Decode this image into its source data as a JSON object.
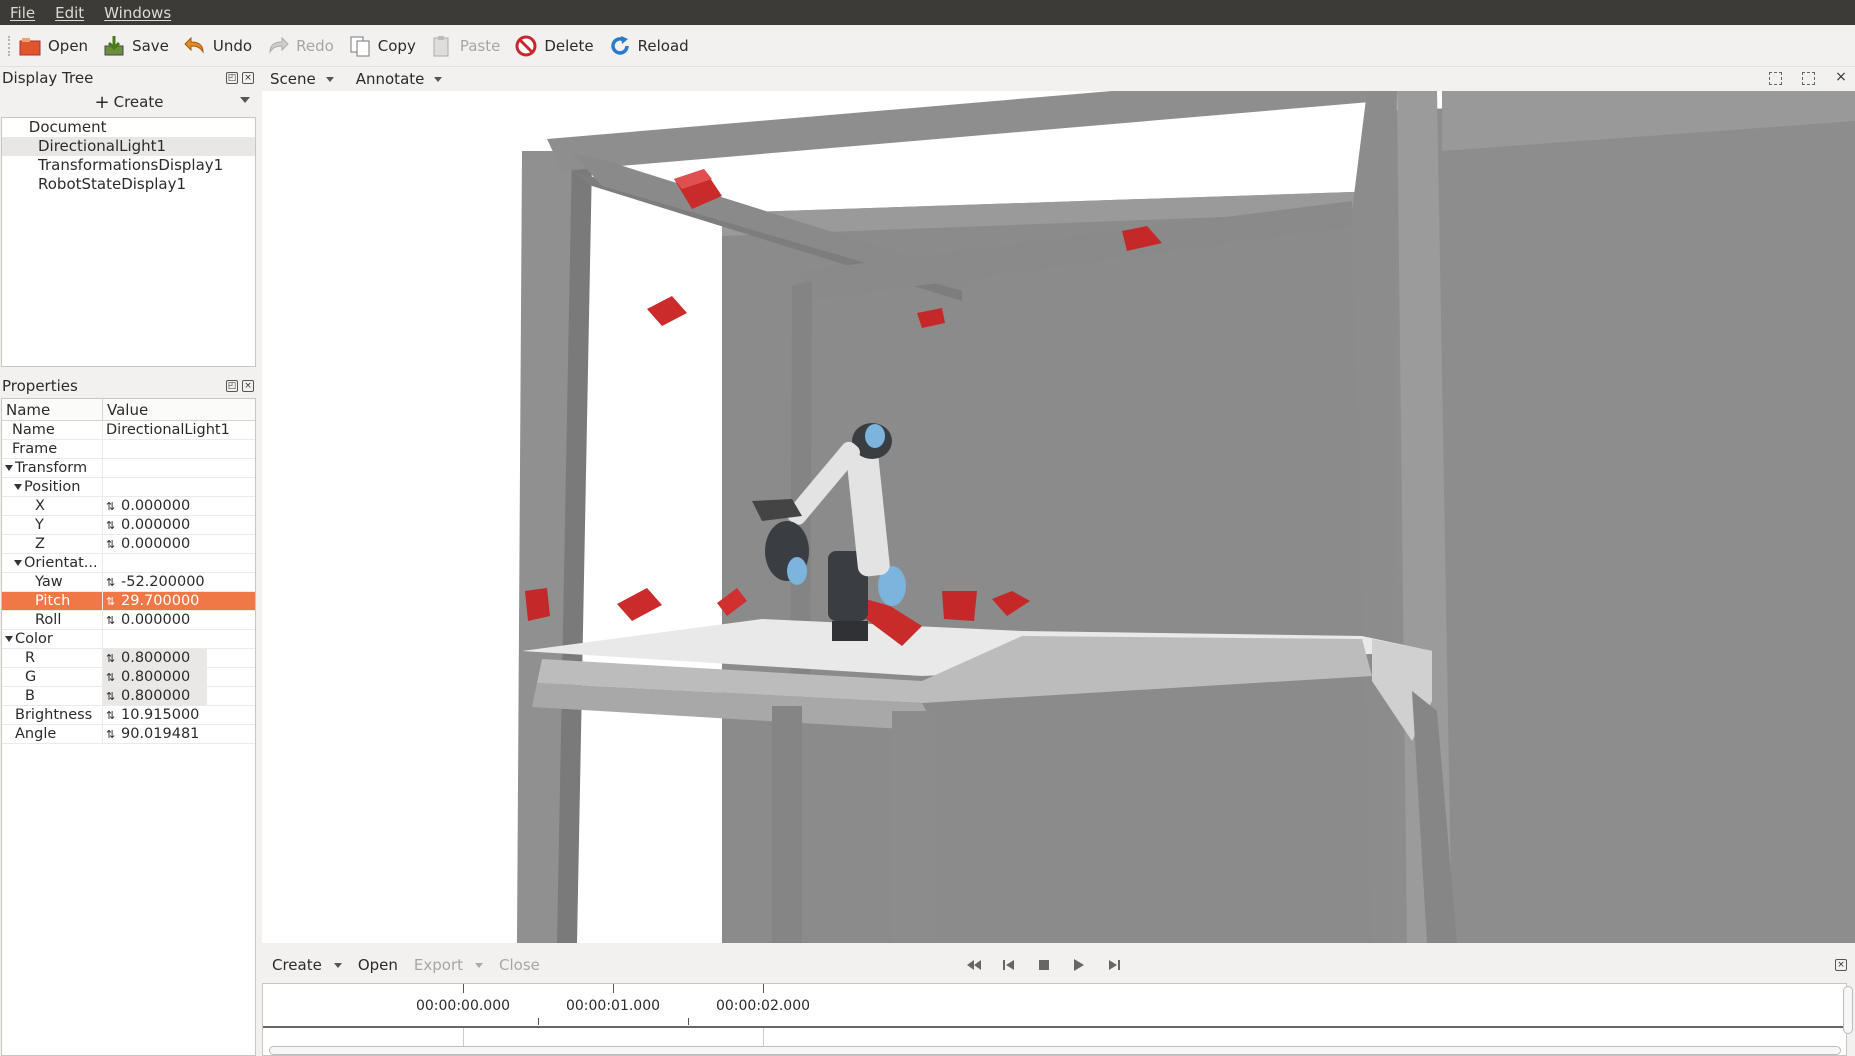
{
  "menubar": {
    "items": [
      "File",
      "Edit",
      "Windows"
    ]
  },
  "toolbar": {
    "open": "Open",
    "save": "Save",
    "undo": "Undo",
    "redo": "Redo",
    "copy": "Copy",
    "paste": "Paste",
    "delete": "Delete",
    "reload": "Reload"
  },
  "display_tree": {
    "title": "Display Tree",
    "create_label": "Create",
    "root": "Document",
    "items": [
      "DirectionalLight1",
      "TransformationsDisplay1",
      "RobotStateDisplay1"
    ],
    "selected": "DirectionalLight1"
  },
  "properties": {
    "title": "Properties",
    "col_name": "Name",
    "col_value": "Value",
    "rows": {
      "name": {
        "label": "Name",
        "value": "DirectionalLight1"
      },
      "frame": {
        "label": "Frame",
        "value": ""
      },
      "transform": {
        "label": "Transform"
      },
      "position": {
        "label": "Position"
      },
      "x": {
        "label": "X",
        "value": "0.000000"
      },
      "y": {
        "label": "Y",
        "value": "0.000000"
      },
      "z": {
        "label": "Z",
        "value": "0.000000"
      },
      "orientation": {
        "label": "Orientat..."
      },
      "yaw": {
        "label": "Yaw",
        "value": "-52.200000"
      },
      "pitch": {
        "label": "Pitch",
        "value": "29.700000"
      },
      "roll": {
        "label": "Roll",
        "value": "0.000000"
      },
      "color": {
        "label": "Color"
      },
      "r": {
        "label": "R",
        "value": "0.800000"
      },
      "g": {
        "label": "G",
        "value": "0.800000"
      },
      "b": {
        "label": "B",
        "value": "0.800000"
      },
      "brightness": {
        "label": "Brightness",
        "value": "10.915000"
      },
      "angle": {
        "label": "Angle",
        "value": "90.019481"
      }
    },
    "selected_row": "Pitch",
    "spin_glyph": "⇅"
  },
  "viewport": {
    "menus": [
      "Scene",
      "Annotate"
    ]
  },
  "timeline": {
    "create": "Create",
    "open": "Open",
    "export": "Export",
    "close": "Close",
    "time_labels": [
      "00:00:00.000",
      "00:00:01.000",
      "00:00:02.000"
    ]
  },
  "colors": {
    "accent_selection": "#f07746",
    "menubar_bg": "#3c3b37",
    "cube_red": "#d42a2a",
    "frame_gray": "#8a8a8a",
    "robot_blue": "#7bb4dc"
  }
}
